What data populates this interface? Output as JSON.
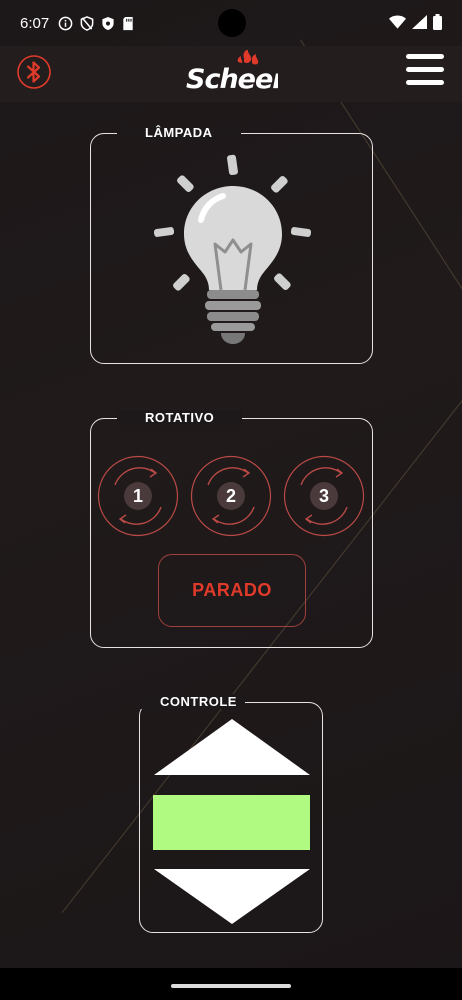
{
  "status_bar": {
    "time": "6:07",
    "left_icons": [
      "info-icon",
      "shield-icon",
      "shield-filled-icon",
      "sd-card-icon"
    ],
    "right_icons": [
      "wifi-icon",
      "signal-icon",
      "battery-icon"
    ]
  },
  "app_bar": {
    "logo_text": "Scheer",
    "bluetooth_icon": "bluetooth-icon",
    "menu_icon": "hamburger-menu-icon"
  },
  "lampada": {
    "title": "LÂMPADA",
    "icon": "light-bulb-icon"
  },
  "rotativo": {
    "title": "ROTATIVO",
    "buttons": [
      "1",
      "2",
      "3"
    ],
    "status_label": "PARADO"
  },
  "controle": {
    "title": "CONTROLE",
    "level_color": "#b1fa82"
  },
  "colors": {
    "background": "#1d1819",
    "accent_red": "#e03a2b",
    "border": "#e8e2e2"
  }
}
